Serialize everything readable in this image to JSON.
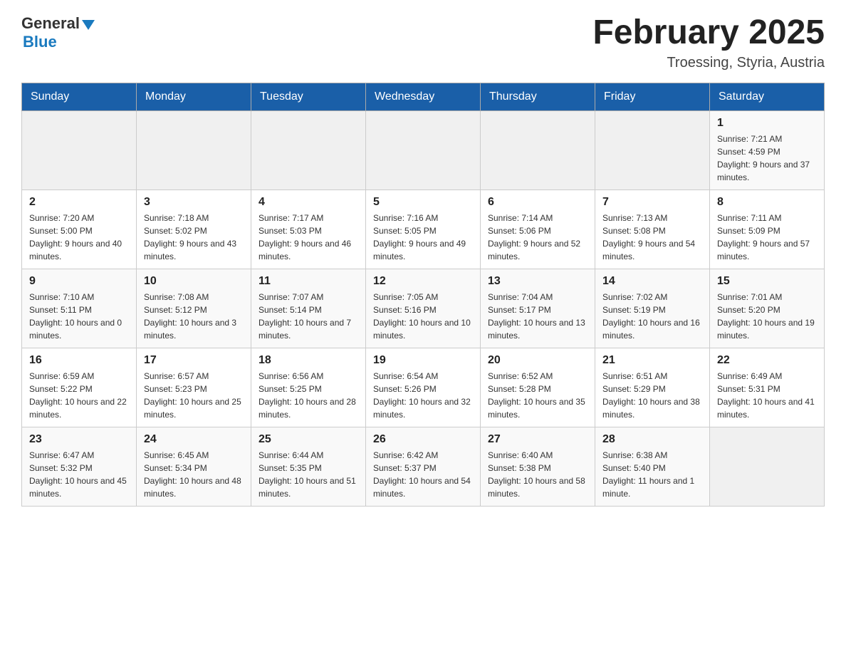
{
  "logo": {
    "general": "General",
    "triangle": "▶",
    "blue": "Blue"
  },
  "title": "February 2025",
  "subtitle": "Troessing, Styria, Austria",
  "days_of_week": [
    "Sunday",
    "Monday",
    "Tuesday",
    "Wednesday",
    "Thursday",
    "Friday",
    "Saturday"
  ],
  "weeks": [
    [
      {
        "day": "",
        "info": ""
      },
      {
        "day": "",
        "info": ""
      },
      {
        "day": "",
        "info": ""
      },
      {
        "day": "",
        "info": ""
      },
      {
        "day": "",
        "info": ""
      },
      {
        "day": "",
        "info": ""
      },
      {
        "day": "1",
        "info": "Sunrise: 7:21 AM\nSunset: 4:59 PM\nDaylight: 9 hours and 37 minutes."
      }
    ],
    [
      {
        "day": "2",
        "info": "Sunrise: 7:20 AM\nSunset: 5:00 PM\nDaylight: 9 hours and 40 minutes."
      },
      {
        "day": "3",
        "info": "Sunrise: 7:18 AM\nSunset: 5:02 PM\nDaylight: 9 hours and 43 minutes."
      },
      {
        "day": "4",
        "info": "Sunrise: 7:17 AM\nSunset: 5:03 PM\nDaylight: 9 hours and 46 minutes."
      },
      {
        "day": "5",
        "info": "Sunrise: 7:16 AM\nSunset: 5:05 PM\nDaylight: 9 hours and 49 minutes."
      },
      {
        "day": "6",
        "info": "Sunrise: 7:14 AM\nSunset: 5:06 PM\nDaylight: 9 hours and 52 minutes."
      },
      {
        "day": "7",
        "info": "Sunrise: 7:13 AM\nSunset: 5:08 PM\nDaylight: 9 hours and 54 minutes."
      },
      {
        "day": "8",
        "info": "Sunrise: 7:11 AM\nSunset: 5:09 PM\nDaylight: 9 hours and 57 minutes."
      }
    ],
    [
      {
        "day": "9",
        "info": "Sunrise: 7:10 AM\nSunset: 5:11 PM\nDaylight: 10 hours and 0 minutes."
      },
      {
        "day": "10",
        "info": "Sunrise: 7:08 AM\nSunset: 5:12 PM\nDaylight: 10 hours and 3 minutes."
      },
      {
        "day": "11",
        "info": "Sunrise: 7:07 AM\nSunset: 5:14 PM\nDaylight: 10 hours and 7 minutes."
      },
      {
        "day": "12",
        "info": "Sunrise: 7:05 AM\nSunset: 5:16 PM\nDaylight: 10 hours and 10 minutes."
      },
      {
        "day": "13",
        "info": "Sunrise: 7:04 AM\nSunset: 5:17 PM\nDaylight: 10 hours and 13 minutes."
      },
      {
        "day": "14",
        "info": "Sunrise: 7:02 AM\nSunset: 5:19 PM\nDaylight: 10 hours and 16 minutes."
      },
      {
        "day": "15",
        "info": "Sunrise: 7:01 AM\nSunset: 5:20 PM\nDaylight: 10 hours and 19 minutes."
      }
    ],
    [
      {
        "day": "16",
        "info": "Sunrise: 6:59 AM\nSunset: 5:22 PM\nDaylight: 10 hours and 22 minutes."
      },
      {
        "day": "17",
        "info": "Sunrise: 6:57 AM\nSunset: 5:23 PM\nDaylight: 10 hours and 25 minutes."
      },
      {
        "day": "18",
        "info": "Sunrise: 6:56 AM\nSunset: 5:25 PM\nDaylight: 10 hours and 28 minutes."
      },
      {
        "day": "19",
        "info": "Sunrise: 6:54 AM\nSunset: 5:26 PM\nDaylight: 10 hours and 32 minutes."
      },
      {
        "day": "20",
        "info": "Sunrise: 6:52 AM\nSunset: 5:28 PM\nDaylight: 10 hours and 35 minutes."
      },
      {
        "day": "21",
        "info": "Sunrise: 6:51 AM\nSunset: 5:29 PM\nDaylight: 10 hours and 38 minutes."
      },
      {
        "day": "22",
        "info": "Sunrise: 6:49 AM\nSunset: 5:31 PM\nDaylight: 10 hours and 41 minutes."
      }
    ],
    [
      {
        "day": "23",
        "info": "Sunrise: 6:47 AM\nSunset: 5:32 PM\nDaylight: 10 hours and 45 minutes."
      },
      {
        "day": "24",
        "info": "Sunrise: 6:45 AM\nSunset: 5:34 PM\nDaylight: 10 hours and 48 minutes."
      },
      {
        "day": "25",
        "info": "Sunrise: 6:44 AM\nSunset: 5:35 PM\nDaylight: 10 hours and 51 minutes."
      },
      {
        "day": "26",
        "info": "Sunrise: 6:42 AM\nSunset: 5:37 PM\nDaylight: 10 hours and 54 minutes."
      },
      {
        "day": "27",
        "info": "Sunrise: 6:40 AM\nSunset: 5:38 PM\nDaylight: 10 hours and 58 minutes."
      },
      {
        "day": "28",
        "info": "Sunrise: 6:38 AM\nSunset: 5:40 PM\nDaylight: 11 hours and 1 minute."
      },
      {
        "day": "",
        "info": ""
      }
    ]
  ]
}
